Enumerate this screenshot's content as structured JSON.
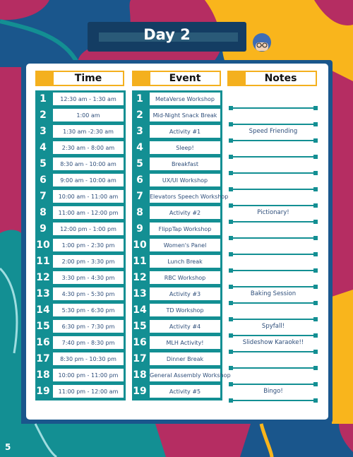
{
  "header": {
    "title": "Day 2"
  },
  "page_number": "5",
  "columns": {
    "time": "Time",
    "event": "Event",
    "notes": "Notes"
  },
  "rows": [
    {
      "n": "1",
      "time": "12:30 am - 1:30 am",
      "event": "MetaVerse Workshop"
    },
    {
      "n": "2",
      "time": "1:00 am",
      "event": "Mid-Night Snack Break"
    },
    {
      "n": "3",
      "time": "1:30 am -2:30 am",
      "event": "Activity #1"
    },
    {
      "n": "4",
      "time": "2:30 am - 8:00 am",
      "event": "Sleep!"
    },
    {
      "n": "5",
      "time": "8:30 am - 10:00 am",
      "event": "Breakfast"
    },
    {
      "n": "6",
      "time": "9:00 am - 10:00 am",
      "event": "UX/UI Workshop"
    },
    {
      "n": "7",
      "time": "10:00 am - 11:00 am",
      "event": "Elevators Speech Workshop"
    },
    {
      "n": "8",
      "time": "11:00 am - 12:00 pm",
      "event": "Activity #2"
    },
    {
      "n": "9",
      "time": "12:00 pm - 1:00 pm",
      "event": "FlippTap Workshop"
    },
    {
      "n": "10",
      "time": "1:00 pm - 2:30 pm",
      "event": "Women's Panel"
    },
    {
      "n": "11",
      "time": "2:00 pm - 3:30 pm",
      "event": "Lunch Break"
    },
    {
      "n": "12",
      "time": "3:30 pm - 4:30 pm",
      "event": "RBC Workshop"
    },
    {
      "n": "13",
      "time": "4:30 pm - 5:30 pm",
      "event": "Activity #3"
    },
    {
      "n": "14",
      "time": "5:30 pm - 6:30 pm",
      "event": "TD Workshop"
    },
    {
      "n": "15",
      "time": "6:30 pm - 7:30 pm",
      "event": "Activity #4"
    },
    {
      "n": "16",
      "time": "7:40 pm - 8:30 pm",
      "event": "MLH Activity!"
    },
    {
      "n": "17",
      "time": "8:30 pm - 10:30 pm",
      "event": "Dinner Break"
    },
    {
      "n": "18",
      "time": "10:00 pm - 11:00 pm",
      "event": "General Assembly Workshop"
    },
    {
      "n": "19",
      "time": "11:00 pm - 12:00 am",
      "event": "Activity #5"
    }
  ],
  "notes": [
    {
      "after_line": 2,
      "text": "Speed Friending"
    },
    {
      "after_line": 7,
      "text": "Pictionary!"
    },
    {
      "after_line": 12,
      "text": "Baking Session"
    },
    {
      "after_line": 14,
      "text": "Spyfall!"
    },
    {
      "after_line": 15,
      "text": "Slideshow Karaoke!!"
    },
    {
      "after_line": 18,
      "text": "Bingo!"
    }
  ],
  "note_line_count": 19,
  "colors": {
    "teal": "#138f93",
    "gold": "#f4b01e",
    "navy": "#143d63",
    "blue": "#1a568c",
    "magenta": "#b52d62"
  }
}
